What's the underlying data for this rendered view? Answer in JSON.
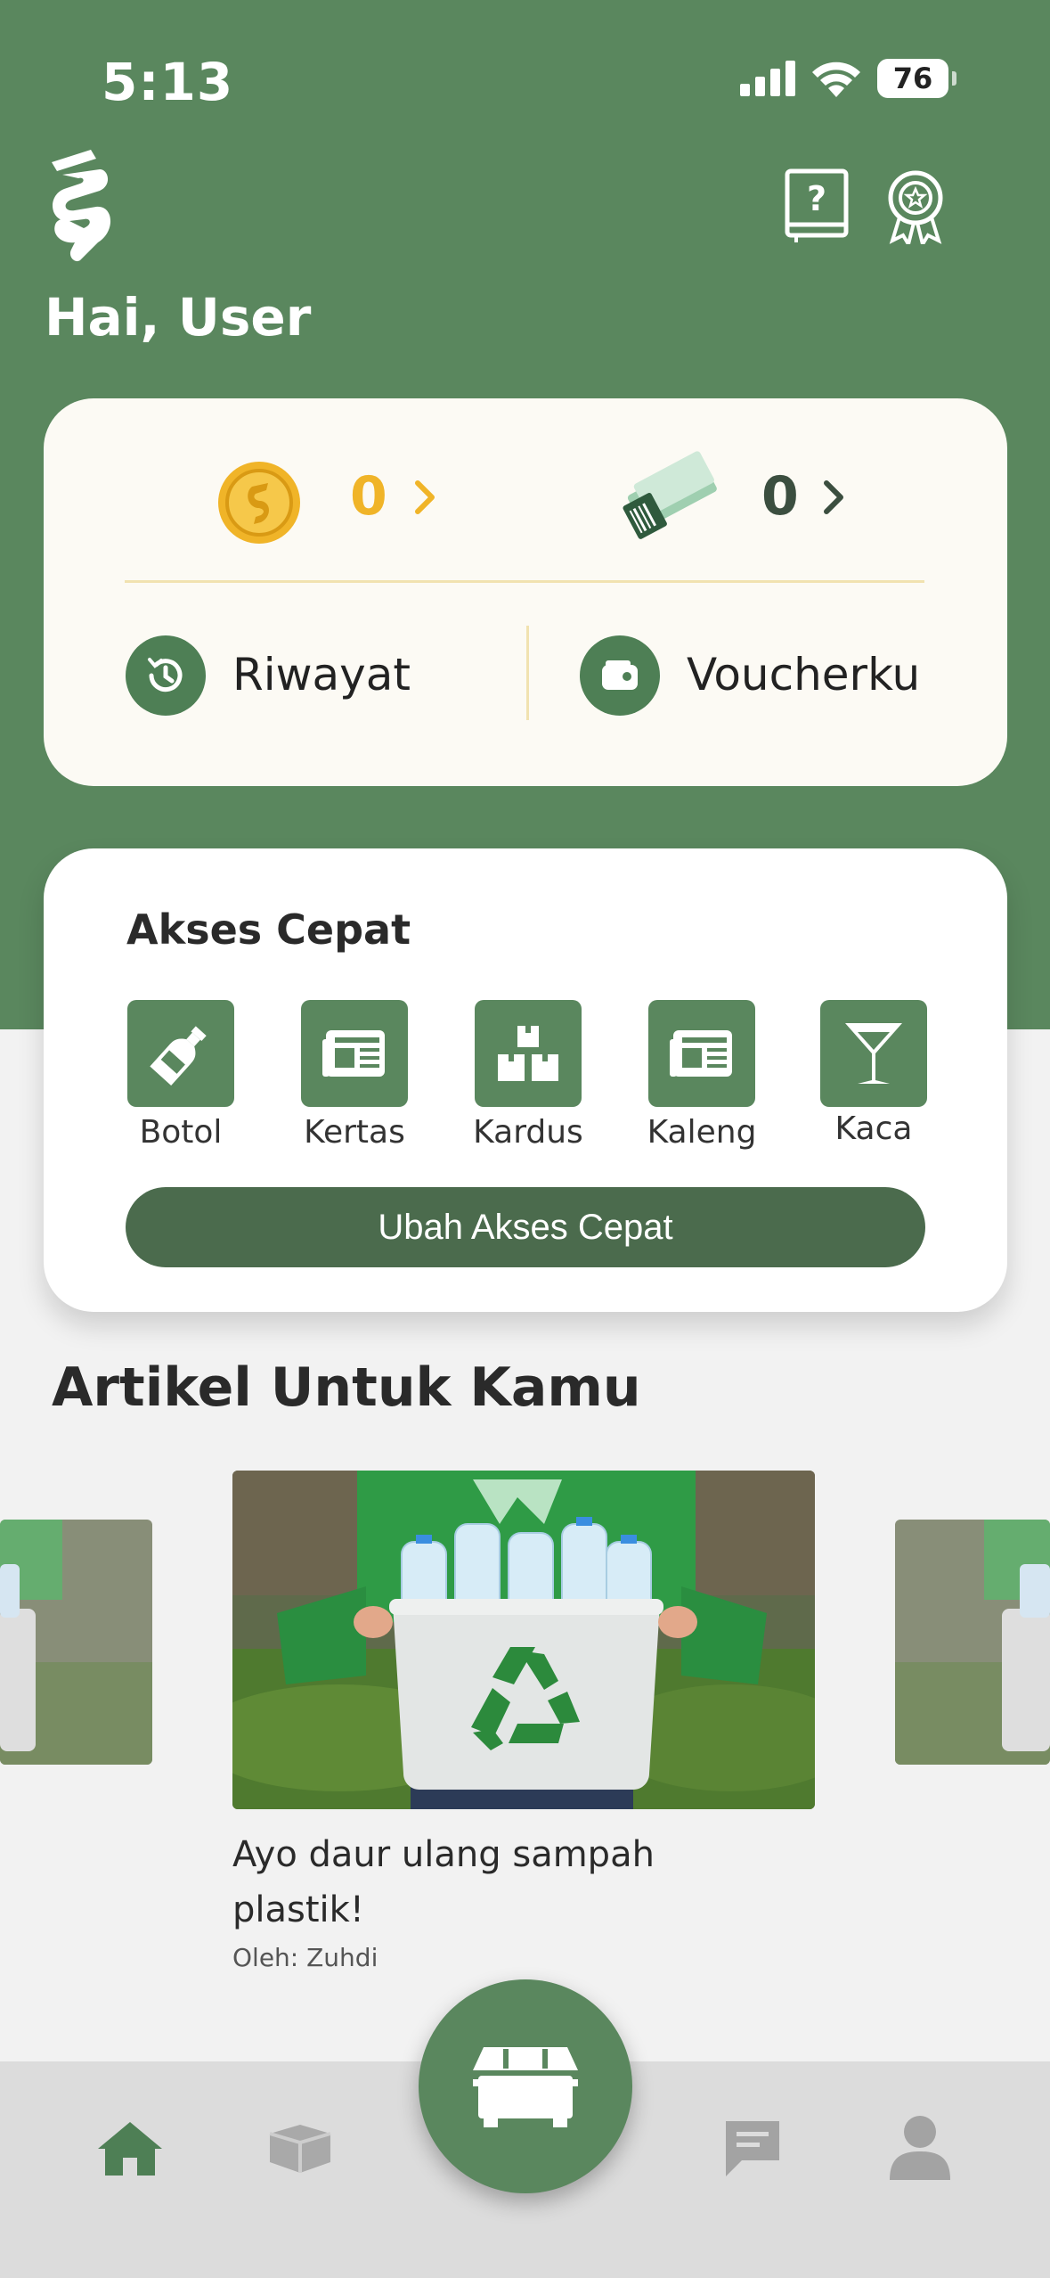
{
  "status_bar": {
    "time": "5:13",
    "battery": "76",
    "icons": [
      "signal-icon",
      "wifi-icon",
      "battery-icon"
    ]
  },
  "header": {
    "greeting": "Hai, User",
    "logo_icon": "app-logo",
    "help_icon": "help-book-icon",
    "badge_icon": "award-badge-icon"
  },
  "points": {
    "coins_value": "0",
    "coins_icon": "coin-icon",
    "vouchers_value": "0",
    "vouchers_icon": "voucher-ticket-icon",
    "history_label": "Riwayat",
    "history_icon": "history-icon",
    "my_voucher_label": "Voucherku",
    "my_voucher_icon": "wallet-icon"
  },
  "quick_access": {
    "title": "Akses Cepat",
    "items": [
      {
        "label": "Botol",
        "icon": "bottle-icon"
      },
      {
        "label": "Kertas",
        "icon": "newspaper-icon"
      },
      {
        "label": "Kardus",
        "icon": "boxes-icon"
      },
      {
        "label": "Kaleng",
        "icon": "newspaper-icon"
      },
      {
        "label": "Kaca",
        "icon": "glass-icon"
      }
    ],
    "edit_button": "Ubah Akses Cepat"
  },
  "articles": {
    "title": "Artikel Untuk Kamu",
    "items": [
      {
        "title": "Ayo daur ulang sampah plastik!",
        "author": "Oleh: Zuhdi"
      }
    ]
  },
  "bottom_nav": {
    "items": [
      "home-icon",
      "box-icon",
      "chat-icon",
      "profile-icon"
    ],
    "fab_icon": "dumpster-icon"
  },
  "colors": {
    "primary": "#5a875e",
    "dark_green": "#4b6b4d",
    "gold": "#f0b428",
    "card": "#fcfaf4",
    "background": "#f2f2f2"
  }
}
